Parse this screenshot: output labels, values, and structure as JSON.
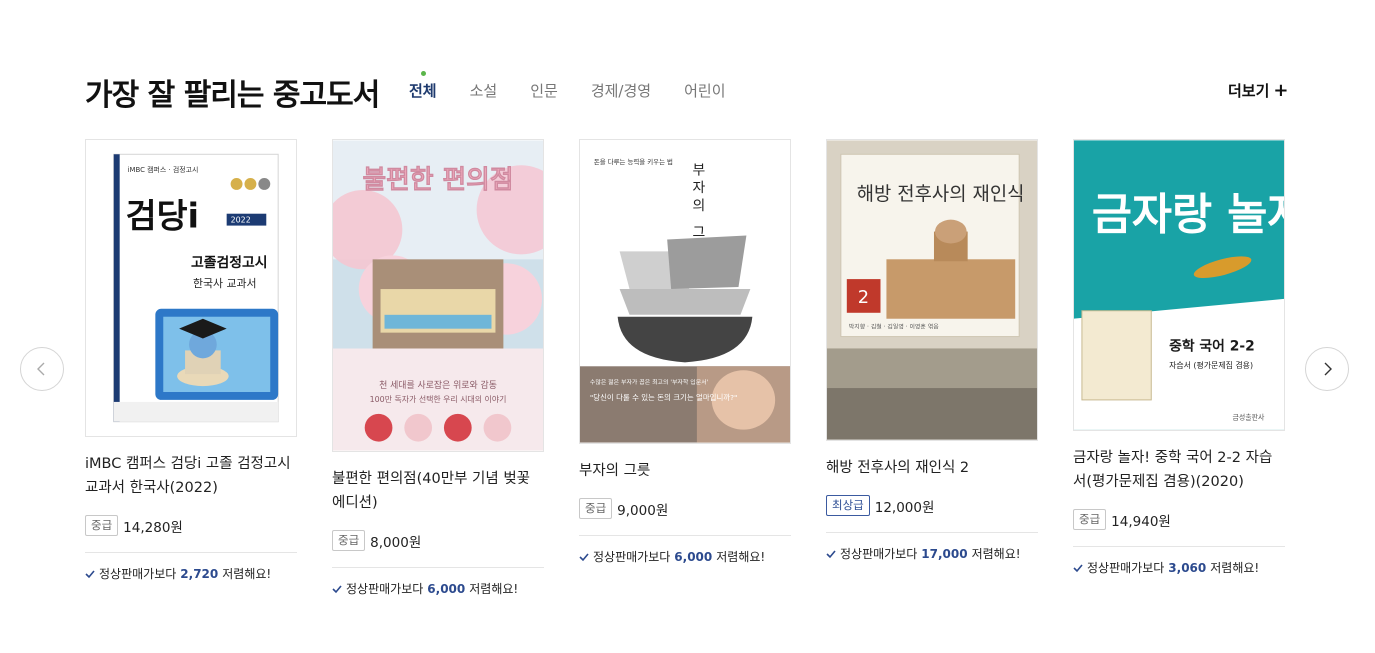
{
  "section": {
    "title": "가장 잘 팔리는 중고도서",
    "more_label": "더보기",
    "more_plus": "+"
  },
  "tabs": [
    {
      "label": "전체",
      "active": true
    },
    {
      "label": "소설",
      "active": false
    },
    {
      "label": "인문",
      "active": false
    },
    {
      "label": "경제/경영",
      "active": false
    },
    {
      "label": "어린이",
      "active": false
    }
  ],
  "icons": {
    "prev": "chevron-left-icon",
    "next": "chevron-right-icon",
    "check": "check-icon"
  },
  "colors": {
    "active_tab": "#1e3a6e",
    "active_dot": "#5bb54a",
    "savings_amount": "#2c4a8e",
    "best_grade_border": "#3b5aa0"
  },
  "save_prefix": "정상판매가보다",
  "save_suffix": "저렴해요!",
  "books": [
    {
      "title": "iMBC 캠퍼스 검당i 고졸 검정고시 교과서 한국사(2022)",
      "grade": "중급",
      "price": "14,280원",
      "save_amount": "2,720",
      "cover": {
        "bg": "#ffffff",
        "brand": "iMBC 캠퍼스 · 검정고시",
        "logo": "검당i",
        "line1": "고졸검정고시",
        "line2": "한국사 교과서",
        "year": "2022"
      }
    },
    {
      "title": "불편한 편의점(40만부 기념 벚꽃 에디션)",
      "grade": "중급",
      "price": "8,000원",
      "save_amount": "6,000",
      "cover": {
        "bg": "#cfe0ea",
        "logo": "불편한 편의점",
        "line1": "천 세대를 사로잡은 위로와 감동",
        "line2": "100만 독자가 선택한 우리 시대의 이야기"
      }
    },
    {
      "title": "부자의 그릇",
      "grade": "중급",
      "price": "9,000원",
      "save_amount": "6,000",
      "cover": {
        "bg": "#ffffff",
        "line1": "돈을 다루는 능력을 키우는 법",
        "logo": "부자의 그릇",
        "line2": "수많은 젊은 부자가 꼽은 최고의 '부자학 입문서'",
        "quote": "\"당신이 다룰 수 있는 돈의 크기는 얼마입니까?\""
      }
    },
    {
      "title": "해방 전후사의 재인식 2",
      "grade": "최상급",
      "price": "12,000원",
      "save_amount": "17,000",
      "cover": {
        "bg": "#d9d2c4",
        "logo": "해방 전후사의 재인식",
        "volume": "2",
        "line1": "박지향 · 김철 · 김일영 · 이영훈 엮음"
      }
    },
    {
      "title": "금자랑 놀자! 중학 국어 2-2 자습서(평가문제집 겸용)(2020)",
      "grade": "중급",
      "price": "14,940원",
      "save_amount": "3,060",
      "cover": {
        "bg": "#19a3a6",
        "logo": "금자랑 놀자!",
        "line1": "중학 국어 2-2",
        "line2": "자습서 (평가문제집 겸용)",
        "publisher": "금성출판사"
      }
    }
  ]
}
